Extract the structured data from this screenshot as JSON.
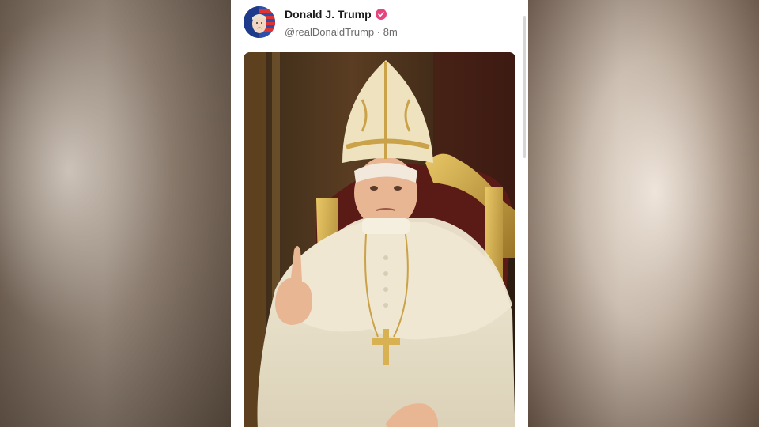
{
  "post": {
    "author": {
      "display_name": "Donald J. Trump",
      "handle": "@realDonaldTrump",
      "time_ago": "8m",
      "verified": true,
      "badge_color": "#e5447f"
    },
    "separator": "·",
    "media": {
      "type": "image",
      "icon": "post-image"
    }
  },
  "colors": {
    "background_card": "#ffffff",
    "name_text": "#1a1a1a",
    "handle_text": "#6b6b6b"
  }
}
